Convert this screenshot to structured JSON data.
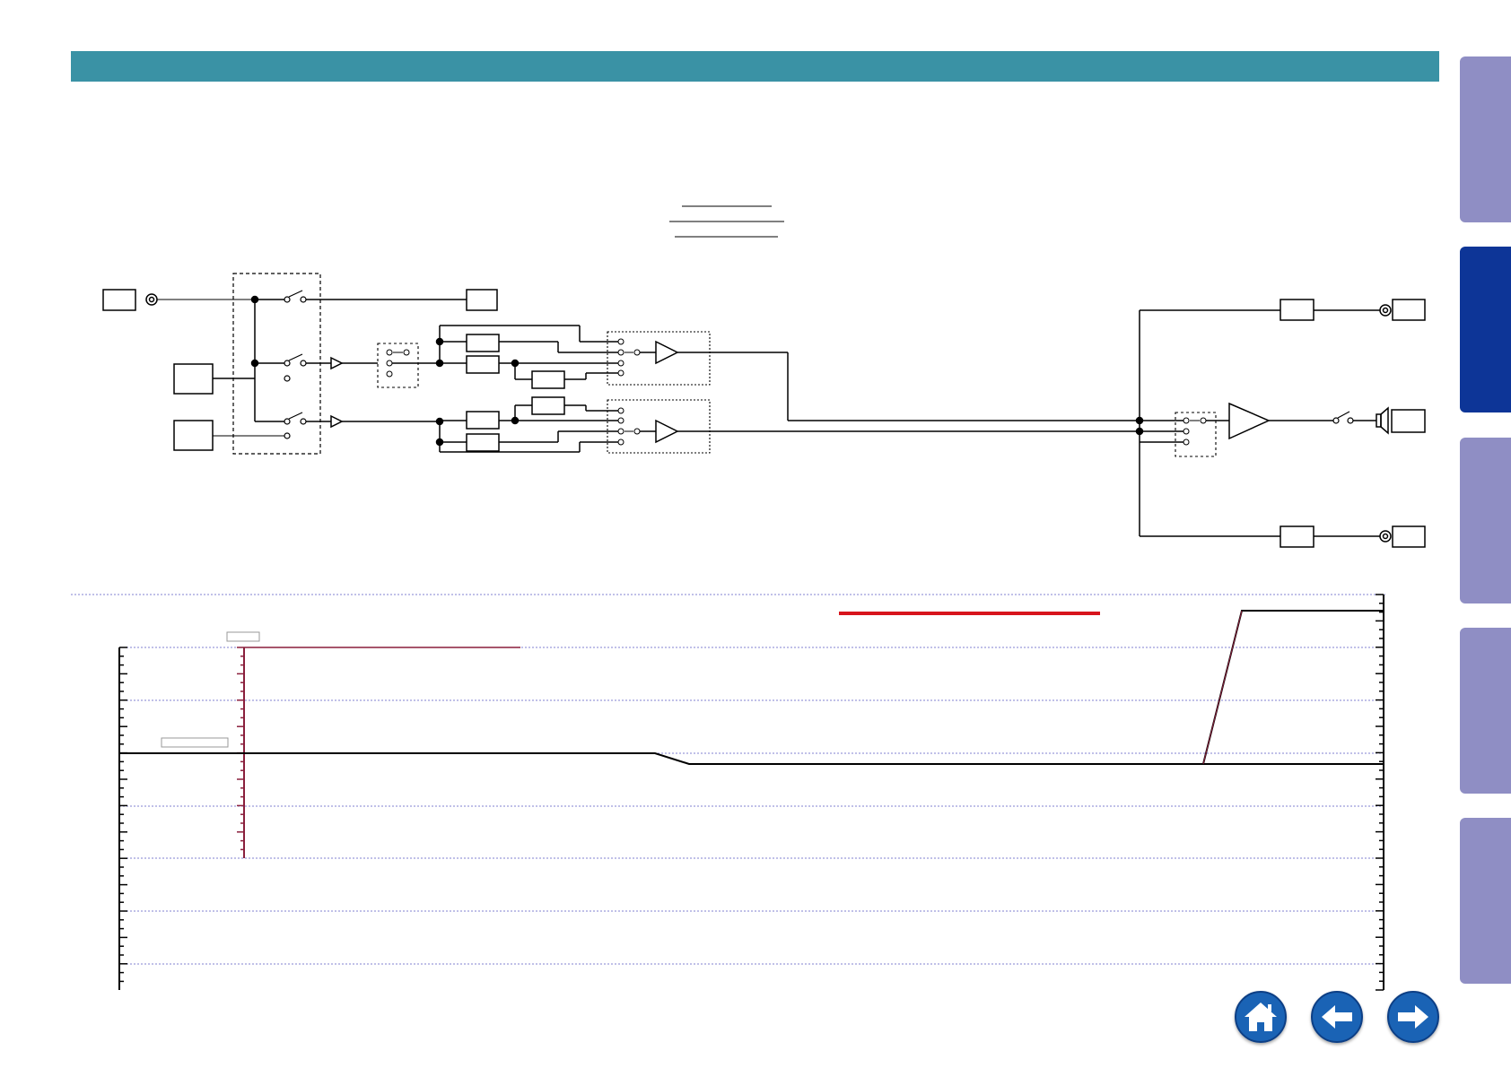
{
  "colors": {
    "header_bar": "#3a92a5",
    "tab_inactive": "#8f8ec4",
    "tab_active": "#0d3597",
    "nav_button": "#1a63b5",
    "nav_button_edge": "#0d3f85",
    "level_line": "#000000",
    "marker_line": "#8a1f3c",
    "red_line": "#d7141c",
    "grid_line": "#8080d0"
  },
  "side_tabs": [
    {
      "name": "side-tab-1",
      "state": "inactive"
    },
    {
      "name": "side-tab-2",
      "state": "active"
    },
    {
      "name": "side-tab-3",
      "state": "inactive"
    },
    {
      "name": "side-tab-4",
      "state": "inactive"
    },
    {
      "name": "side-tab-5",
      "state": "inactive"
    }
  ],
  "nav_buttons": [
    {
      "name": "home-button",
      "icon": "home-icon"
    },
    {
      "name": "back-button",
      "icon": "arrow-left-icon"
    },
    {
      "name": "forward-button",
      "icon": "arrow-right-icon"
    }
  ],
  "level_chart": {
    "grid": true,
    "left_axis_ticks": true,
    "right_axis_ticks": true
  }
}
